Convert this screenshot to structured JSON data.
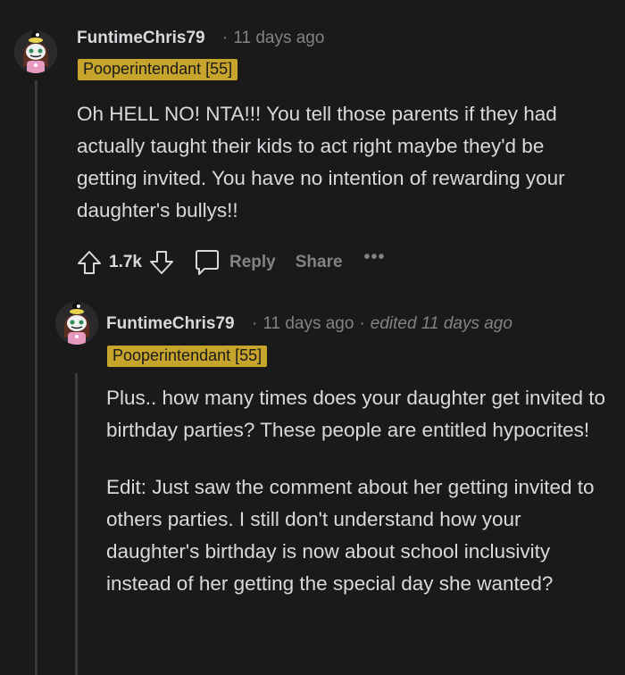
{
  "comments": [
    {
      "username": "FuntimeChris79",
      "time": "11 days ago",
      "flair": "Pooperintendant [55]",
      "body": [
        "Oh HELL NO! NTA!!! You tell those parents if they had actually taught their kids to act right maybe they'd be getting invited. You have no intention of rewarding your daughter's bullys!!"
      ],
      "score": "1.7k",
      "reply_label": "Reply",
      "share_label": "Share",
      "more_label": "•••"
    },
    {
      "username": "FuntimeChris79",
      "time": "11 days ago",
      "edited": "edited 11 days ago",
      "flair": "Pooperintendant [55]",
      "body": [
        "Plus.. how many times does your daughter get invited to birthday parties? These people are entitled hypocrites!",
        "Edit: Just saw the comment about her getting invited to others parties. I still don't understand how your daughter's birthday is now about school inclusivity instead of her getting the special day she wanted?"
      ]
    }
  ],
  "separator": "·",
  "colors": {
    "background": "#1a1a1b",
    "text": "#d7dadc",
    "muted": "#818384",
    "flair_bg": "#c7a42b"
  },
  "icons": {
    "avatar": "avatar-icon",
    "upvote": "upvote-icon",
    "downvote": "downvote-icon",
    "reply": "comment-bubble-icon"
  }
}
